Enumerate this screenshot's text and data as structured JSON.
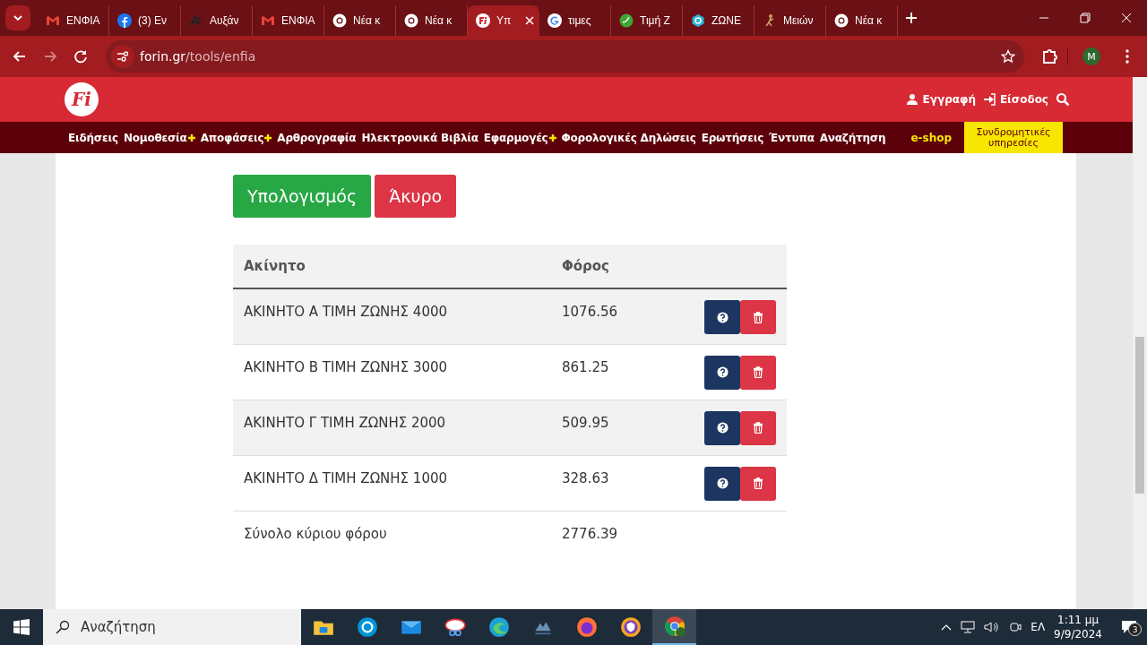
{
  "browser": {
    "tabs": [
      {
        "title": "ΕΝΦΙΑ",
        "selected": false
      },
      {
        "title": "(3) Εν",
        "selected": false
      },
      {
        "title": "Αυξάν",
        "selected": false
      },
      {
        "title": "ΕΝΦΙΑ",
        "selected": false
      },
      {
        "title": "Νέα κ",
        "selected": false
      },
      {
        "title": "Νέα κ",
        "selected": false
      },
      {
        "title": "Υπ",
        "selected": true
      },
      {
        "title": "τιμες",
        "selected": false
      },
      {
        "title": "Τιμή Ζ",
        "selected": false
      },
      {
        "title": "ΖΩΝΕ",
        "selected": false
      },
      {
        "title": "Μειών",
        "selected": false
      },
      {
        "title": "Νέα κ",
        "selected": false
      }
    ],
    "address": {
      "host": "forin.gr",
      "path": "/tools/enfia"
    },
    "profile": "M"
  },
  "site": {
    "logo": "Fi",
    "account": [
      {
        "kind": "user",
        "label": "Εγγραφή"
      },
      {
        "kind": "login",
        "label": "Είσοδος"
      }
    ],
    "nav": [
      {
        "label": "Ειδήσεις",
        "kind": "link",
        "plus": false
      },
      {
        "label": "Νομοθεσία",
        "kind": "link",
        "plus": true
      },
      {
        "label": "Αποφάσεις",
        "kind": "link",
        "plus": true
      },
      {
        "label": "Αρθρογραφία",
        "kind": "link",
        "plus": false
      },
      {
        "label": "Ηλεκτρονικά Βιβλία",
        "kind": "link",
        "plus": false
      },
      {
        "label": "Εφαρμογές",
        "kind": "link",
        "plus": true
      },
      {
        "label": "Φορολογικές Δηλώσεις",
        "kind": "link",
        "plus": false
      },
      {
        "label": "Ερωτήσεις",
        "kind": "link",
        "plus": false
      },
      {
        "label": "Έντυπα",
        "kind": "link",
        "plus": false
      },
      {
        "label": "Αναζήτηση",
        "kind": "link",
        "plus": false
      },
      {
        "label": "e-shop",
        "kind": "shop"
      },
      {
        "label": "Συνδρομητικές υπηρεσίες",
        "kind": "promo"
      }
    ]
  },
  "actions": [
    {
      "label": "Υπολογισμός",
      "kind": "primary"
    },
    {
      "label": "Άκυρο",
      "kind": "danger"
    }
  ],
  "table": {
    "columns": [
      "Ακίνητο",
      "Φόρος"
    ],
    "rows": [
      {
        "property": "ΑΚΙΝΗΤΟ Α ΤΙΜΗ ΖΩΝΗΣ 4000",
        "tax": "1076.56"
      },
      {
        "property": "ΑΚΙΝΗΤΟ Β ΤΙΜΗ ΖΩΝΗΣ 3000",
        "tax": "861.25"
      },
      {
        "property": "ΑΚΙΝΗΤΟ Γ ΤΙΜΗ ΖΩΝΗΣ 2000",
        "tax": "509.95"
      },
      {
        "property": "ΑΚΙΝΗΤΟ Δ ΤΙΜΗ ΖΩΝΗΣ 1000",
        "tax": "328.63"
      }
    ],
    "total": {
      "label": "Σύνολο κύριου φόρου",
      "value": "2776.39"
    }
  },
  "taskbar": {
    "search_placeholder": "Αναζήτηση",
    "apps": [
      {
        "selected": false
      },
      {
        "selected": false
      },
      {
        "selected": false
      },
      {
        "selected": false
      },
      {
        "selected": false
      },
      {
        "selected": false
      },
      {
        "selected": false
      },
      {
        "selected": false
      },
      {
        "selected": true
      }
    ],
    "language": "ΕΛ",
    "time": "1:11 μμ",
    "date": "9/9/2024",
    "notifications": "3"
  }
}
